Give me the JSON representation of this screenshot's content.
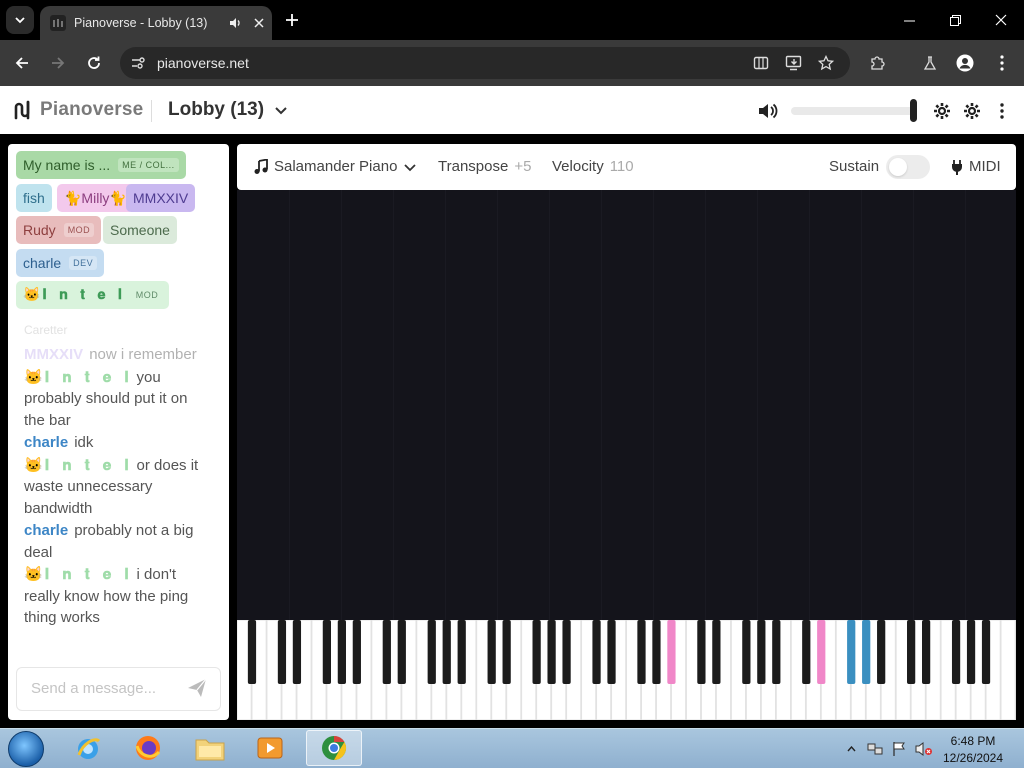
{
  "browser": {
    "tab_title": "Pianoverse - Lobby (13)",
    "url": "pianoverse.net",
    "icons": [
      "tab-list-icon",
      "speaker-icon",
      "close-icon",
      "plus-icon",
      "minimize-icon",
      "restore-icon",
      "close-window-icon",
      "back-icon",
      "forward-icon",
      "reload-icon",
      "site-info-icon",
      "reading-mode-icon",
      "install-app-icon",
      "star-icon",
      "extensions-icon",
      "labs-icon",
      "profile-icon",
      "kebab-icon"
    ]
  },
  "app": {
    "brand": "Pianoverse",
    "room": "Lobby (13)",
    "volume_fraction": 0.98,
    "icons": [
      "volume-icon",
      "gear-icon",
      "settings-icon",
      "kebab-icon"
    ]
  },
  "users": [
    {
      "name": "My name is ...",
      "tag": "ME / COL...",
      "bg": "#a9d9a6",
      "fg": "#2f5e2b"
    },
    {
      "name": "fish",
      "tag": "",
      "bg": "#bfe3ee",
      "fg": "#2f6f8c"
    },
    {
      "name": "🐈Milly🐈",
      "tag": "",
      "bg": "#f3c9ec",
      "fg": "#8c3e80"
    },
    {
      "name": "MMXXIV",
      "tag": "",
      "bg": "#c9b8f0",
      "fg": "#4f3c91"
    },
    {
      "name": "Rudy",
      "tag": "MOD",
      "bg": "#e8bcbc",
      "fg": "#8e3f3f"
    },
    {
      "name": "Someone",
      "tag": "",
      "bg": "#dbeadb",
      "fg": "#4d6b4d"
    },
    {
      "name": "charle",
      "tag": "DEV",
      "bg": "#c4dcf1",
      "fg": "#2d5f8e"
    },
    {
      "name": "🐱𝐈 𝐧 𝐭 𝐞 𝐥",
      "tag": "MOD",
      "bg": "#d9f3dc",
      "fg": "#3e9b57"
    }
  ],
  "chat": {
    "faded_label": "Caretter",
    "messages": [
      {
        "from": "MMXXIV",
        "text": "now i remember",
        "color": "#c9b8f0",
        "faded": true
      },
      {
        "from": "🐱𝐈 𝐧 𝐭 𝐞 𝐥",
        "text": "you probably should put it on the bar",
        "color": "#9fdca9",
        "faded": false
      },
      {
        "from": "charle",
        "text": "idk",
        "color": "#3d86c6",
        "faded": false
      },
      {
        "from": "🐱𝐈 𝐧 𝐭 𝐞 𝐥",
        "text": "or does it waste unnecessary bandwidth",
        "color": "#9fdca9",
        "faded": false
      },
      {
        "from": "charle",
        "text": "probably not a big deal",
        "color": "#3d86c6",
        "faded": false
      },
      {
        "from": "🐱𝐈 𝐧 𝐭 𝐞 𝐥",
        "text": "i don't really know how the ping thing works",
        "color": "#9fdca9",
        "faded": false
      }
    ],
    "input_placeholder": "Send a message...",
    "send_icon": "paper-plane-icon"
  },
  "controls": {
    "instrument": "Salamander Piano",
    "transpose_label": "Transpose",
    "transpose_value": "+5",
    "velocity_label": "Velocity",
    "velocity_value": "110",
    "sustain_label": "Sustain",
    "sustain_on": false,
    "midi_label": "MIDI",
    "icons": [
      "music-note-icon",
      "chevron-down-icon",
      "plug-icon"
    ]
  },
  "keyboard": {
    "white_keys": 52,
    "pressed_black_keys": [
      {
        "key": "pink",
        "color": "#f087c8"
      },
      {
        "key": "pink",
        "color": "#f087c8"
      },
      {
        "key": "blue",
        "color": "#3a8fc0"
      },
      {
        "key": "blue",
        "color": "#3a8fc0"
      }
    ]
  },
  "taskbar": {
    "apps": [
      "internet-explorer-icon",
      "firefox-icon",
      "file-explorer-icon",
      "media-player-icon",
      "chrome-icon"
    ],
    "time": "6:48 PM",
    "date": "12/26/2024"
  }
}
